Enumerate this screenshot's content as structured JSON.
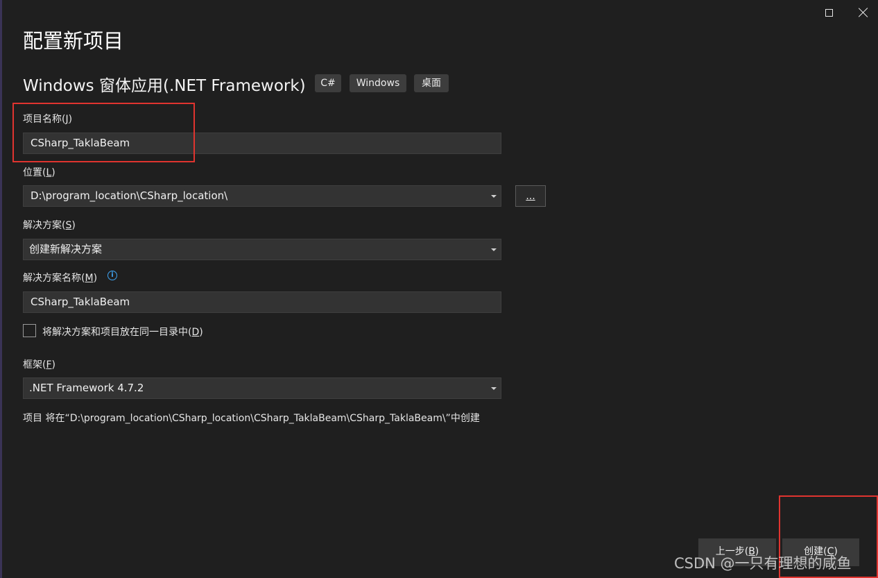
{
  "window": {
    "title": "配置新项目",
    "template_name": "Windows 窗体应用(.NET Framework)",
    "tags": [
      "C#",
      "Windows",
      "桌面"
    ]
  },
  "project_name": {
    "label": "项目名称(",
    "mnemonic": "J",
    "label_end": ")",
    "value": "CSharp_TaklaBeam"
  },
  "location": {
    "label": "位置(",
    "mnemonic": "L",
    "label_end": ")",
    "value": "D:\\program_location\\CSharp_location\\",
    "browse_label": "..."
  },
  "solution": {
    "label": "解决方案(",
    "mnemonic": "S",
    "label_end": ")",
    "value": "创建新解决方案"
  },
  "solution_name": {
    "label": "解决方案名称(",
    "mnemonic": "M",
    "label_end": ")",
    "info_glyph": "i",
    "value": "CSharp_TaklaBeam"
  },
  "same_dir": {
    "label": "将解决方案和项目放在同一目录中(",
    "mnemonic": "D",
    "label_end": ")",
    "checked": false
  },
  "framework": {
    "label": "框架(",
    "mnemonic": "F",
    "label_end": ")",
    "value": ".NET Framework 4.7.2"
  },
  "path_note": "项目 将在“D:\\program_location\\CSharp_location\\CSharp_TaklaBeam\\CSharp_TaklaBeam\\”中创建",
  "footer": {
    "back_label": "上一步(",
    "back_mnemonic": "B",
    "back_end": ")",
    "create_label": "创建(",
    "create_mnemonic": "C",
    "create_end": ")"
  },
  "watermark": "CSDN @一只有理想的咸鱼",
  "colors": {
    "background": "#1f1f1f",
    "field": "#333333",
    "highlight": "#e0342f",
    "info": "#3fa5f4"
  }
}
